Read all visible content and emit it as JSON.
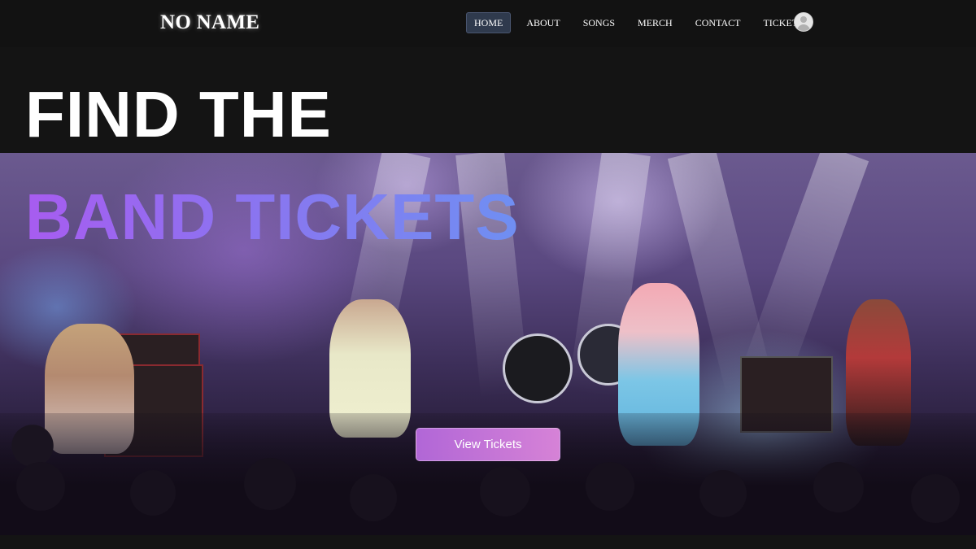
{
  "brand": {
    "name": "NO NAME"
  },
  "nav": {
    "items": [
      {
        "label": "HOME",
        "active": true
      },
      {
        "label": "ABOUT",
        "active": false
      },
      {
        "label": "SONGS",
        "active": false
      },
      {
        "label": "MERCH",
        "active": false
      },
      {
        "label": "CONTACT",
        "active": false
      },
      {
        "label": "TICKETS",
        "active": false
      }
    ],
    "avatar_icon": "user-avatar-icon"
  },
  "hero": {
    "title_line1": "FIND THE",
    "title_line2": "BAND TICKETS",
    "cta_label": "View Tickets",
    "image": "concert-stage-photo"
  },
  "colors": {
    "background": "#141414",
    "active_nav": "#2f3a4d",
    "gradient_start": "#a75cf0",
    "gradient_end": "#6f8ff2",
    "cta_start": "#be6ee6",
    "cta_end": "#e68ce6"
  }
}
